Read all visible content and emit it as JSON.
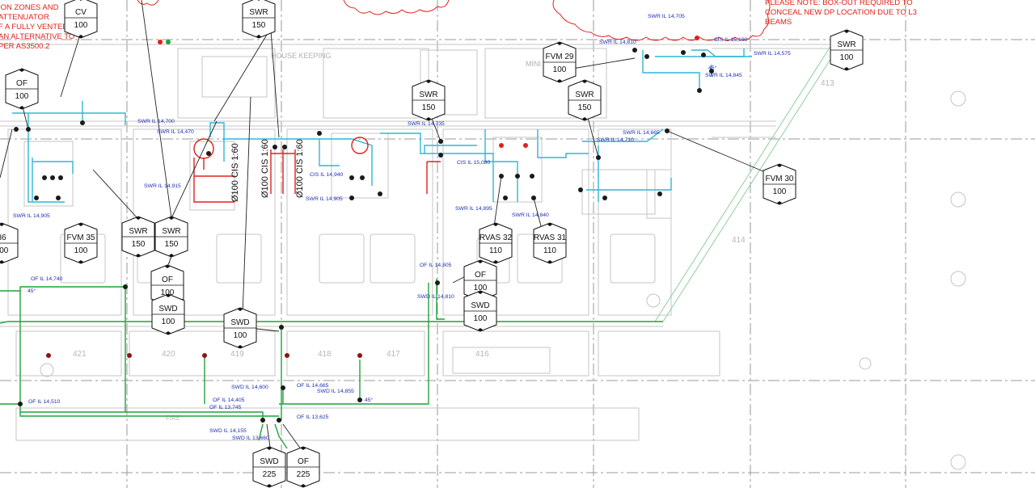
{
  "colors": {
    "background": "#ffffff",
    "grid_dash": "#9a9a9a",
    "architecture": "#c4c4c4",
    "cold_water": "#2fb7d6",
    "sewer_red": "#e0201a",
    "stormwater_green": "#1fa33a",
    "leader": "#222222",
    "label_blue": "#1e2fb0",
    "revision_cloud": "#e0201a"
  },
  "notes": {
    "top_left": [
      "ION ZONES AND",
      "ATTENUATOR",
      "F A FULLY VENTED",
      "AN ALTERNATIVE TO",
      "PER AS3500.2"
    ],
    "top_right": [
      "PLEASE NOTE: BOX-OUT REQUIRED TO",
      "CONCEAL NEW DP LOCATION DUE TO L3",
      "BEAMS"
    ]
  },
  "rooms": {
    "house_keeping": "HOUSE KEEPING",
    "mini_store": "MINI STO"
  },
  "tags": [
    {
      "top": "CV",
      "bottom": "100"
    },
    {
      "top": "SWR",
      "bottom": "150"
    },
    {
      "top": "OF",
      "bottom": "100"
    },
    {
      "top": "SWR",
      "bottom": "100"
    },
    {
      "top": "FVM 29",
      "bottom": "100"
    },
    {
      "top": "SWR",
      "bottom": "150"
    },
    {
      "top": "SWR",
      "bottom": "150"
    },
    {
      "top": "FVM 30",
      "bottom": "100"
    },
    {
      "top": "FVM 35",
      "bottom": "100"
    },
    {
      "top": "SWR",
      "bottom": "150"
    },
    {
      "top": "SWR",
      "bottom": "150"
    },
    {
      "top": "RVAS 32",
      "bottom": "110"
    },
    {
      "top": "RVAS 31",
      "bottom": "110"
    },
    {
      "top": "OF",
      "bottom": "100"
    },
    {
      "top": "SWD",
      "bottom": "100"
    },
    {
      "top": "OF",
      "bottom": "100"
    },
    {
      "top": "SWD",
      "bottom": "100"
    },
    {
      "top": "SWD",
      "bottom": "100"
    },
    {
      "top": "SWD",
      "bottom": "225"
    },
    {
      "top": "OF",
      "bottom": "225"
    },
    {
      "top": "36",
      "bottom": "100"
    }
  ],
  "pipe_labels": [
    "SWR IL 14,700",
    "SWR IL 14,470",
    "SWR IL 14,915",
    "SWR IL 14,905",
    "SWR IL 14,735",
    "CIS IL 15,080",
    "CIS IL 14,940",
    "SWR IL 14,905",
    "SWR IL 14,895",
    "SWR IL 14,840",
    "SWR IL 14,710",
    "SWR IL 14,665",
    "SWR IL 14,705",
    "SWR IL 14,810",
    "CIS IL 15,100",
    "SWR IL 14,575",
    "SWR IL 14,845",
    "45°",
    "OF IL 14,740",
    "45°",
    "OF IL 14,805",
    "SWD IL 14,810",
    "SWD IL 14,600",
    "OF IL 14,665",
    "SWD IL 14,855",
    "45°",
    "OF IL 14,405",
    "OF IL 13,745",
    "OF IL 14,510",
    "OF IL 13,625",
    "SWD IL 14,155",
    "SWD IL 13,660"
  ],
  "pipe_sizes": [
    "Ø100 CIS 1:60",
    "Ø100 CIS 1:60",
    "Ø100 CIS 1:60"
  ]
}
